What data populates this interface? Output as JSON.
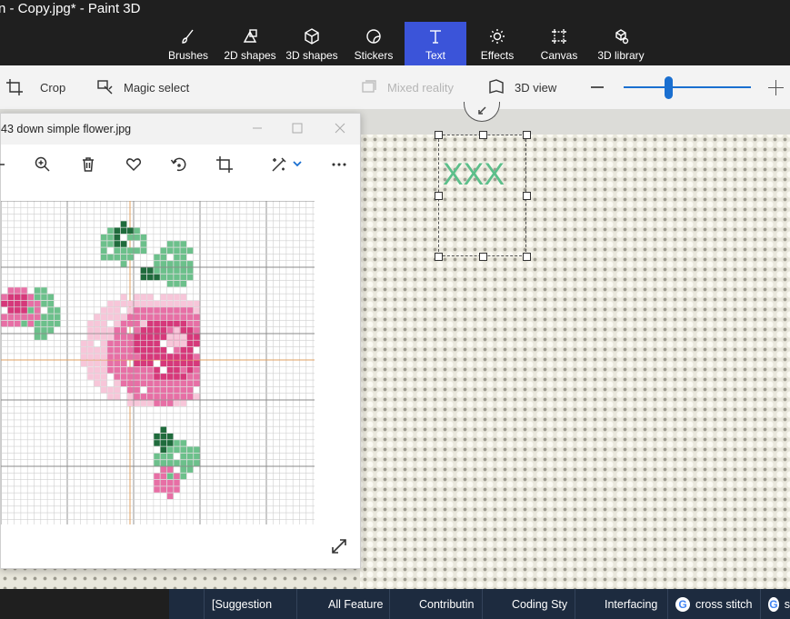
{
  "window": {
    "title": "n - Copy.jpg* - Paint 3D"
  },
  "tools": [
    {
      "id": "brushes",
      "label": "Brushes",
      "icon": "brush-icon"
    },
    {
      "id": "2d-shapes",
      "label": "2D shapes",
      "icon": "2d-shapes-icon"
    },
    {
      "id": "3d-shapes",
      "label": "3D shapes",
      "icon": "cube-icon"
    },
    {
      "id": "stickers",
      "label": "Stickers",
      "icon": "sticker-icon"
    },
    {
      "id": "text",
      "label": "Text",
      "icon": "text-icon",
      "active": true
    },
    {
      "id": "effects",
      "label": "Effects",
      "icon": "sun-icon"
    },
    {
      "id": "canvas",
      "label": "Canvas",
      "icon": "canvas-icon"
    },
    {
      "id": "3d-library",
      "label": "3D library",
      "icon": "3d-library-icon"
    }
  ],
  "toolbar2": {
    "crop": "Crop",
    "magic_select": "Magic select",
    "mixed_reality": "Mixed reality",
    "view_3d": "3D view",
    "zoom_level": 0.35
  },
  "textbox": {
    "text": "XXX",
    "color": "#5bbf8a"
  },
  "viewer": {
    "title": "43 down simple flower.jpg",
    "toolbar_icons": [
      "zoom-out-icon",
      "zoom-in-icon",
      "delete-icon",
      "favorite-icon",
      "rotate-icon",
      "crop-icon",
      "edit-icon",
      "more-icon"
    ]
  },
  "taskbar": {
    "items": [
      {
        "label": "[Suggestion",
        "icon": "edge-icon"
      },
      {
        "label": "All Feature",
        "icon": "edge-icon"
      },
      {
        "label": "Contributin",
        "icon": "edge-icon"
      },
      {
        "label": "Coding Sty",
        "icon": "edge-icon"
      },
      {
        "label": "Interfacing",
        "icon": "edge-icon"
      },
      {
        "label": "cross stitch",
        "icon": "google-icon"
      },
      {
        "label": "s",
        "icon": "google-icon"
      }
    ]
  },
  "colors": {
    "accent": "#3b54d9",
    "zoom": "#1a6fd0",
    "pink_dark": "#d6387a",
    "pink_mid": "#e76fa5",
    "pink_light": "#f7c6d9",
    "leaf_dark": "#1f6b3c",
    "leaf_light": "#6cc08b"
  }
}
